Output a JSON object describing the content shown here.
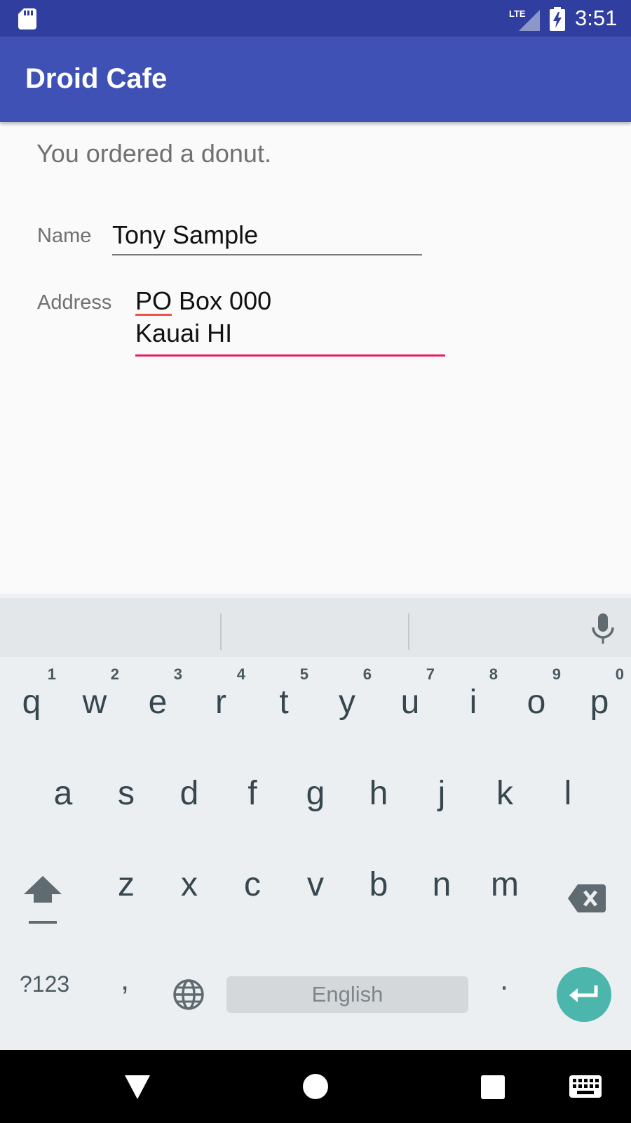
{
  "status_bar": {
    "time": "3:51",
    "network_label": "LTE",
    "icons": [
      "sd-card-icon",
      "lte-signal-icon",
      "battery-charging-icon"
    ]
  },
  "app_bar": {
    "title": "Droid Cafe"
  },
  "order": {
    "message": "You ordered a donut."
  },
  "form": {
    "name": {
      "label": "Name",
      "value": "Tony Sample"
    },
    "address": {
      "label": "Address",
      "line1": "PO Box 000",
      "line2": "Kauai HI"
    }
  },
  "keyboard": {
    "row1": [
      {
        "key": "q",
        "hint": "1"
      },
      {
        "key": "w",
        "hint": "2"
      },
      {
        "key": "e",
        "hint": "3"
      },
      {
        "key": "r",
        "hint": "4"
      },
      {
        "key": "t",
        "hint": "5"
      },
      {
        "key": "y",
        "hint": "6"
      },
      {
        "key": "u",
        "hint": "7"
      },
      {
        "key": "i",
        "hint": "8"
      },
      {
        "key": "o",
        "hint": "9"
      },
      {
        "key": "p",
        "hint": "0"
      }
    ],
    "row2": [
      "a",
      "s",
      "d",
      "f",
      "g",
      "h",
      "j",
      "k",
      "l"
    ],
    "row3": [
      "z",
      "x",
      "c",
      "v",
      "b",
      "n",
      "m"
    ],
    "symbols_label": "?123",
    "comma_label": ",",
    "space_label": "English",
    "period_label": ".",
    "icons": [
      "mic-icon",
      "shift-icon",
      "backspace-icon",
      "globe-icon",
      "enter-icon"
    ]
  },
  "nav_bar": {
    "icons": [
      "back-icon",
      "home-icon",
      "recents-icon",
      "keyboard-switch-icon"
    ]
  },
  "colors": {
    "status_bar": "#303f9f",
    "app_bar": "#3f51b5",
    "accent": "#e91e63",
    "enter_key": "#4db6ac"
  }
}
